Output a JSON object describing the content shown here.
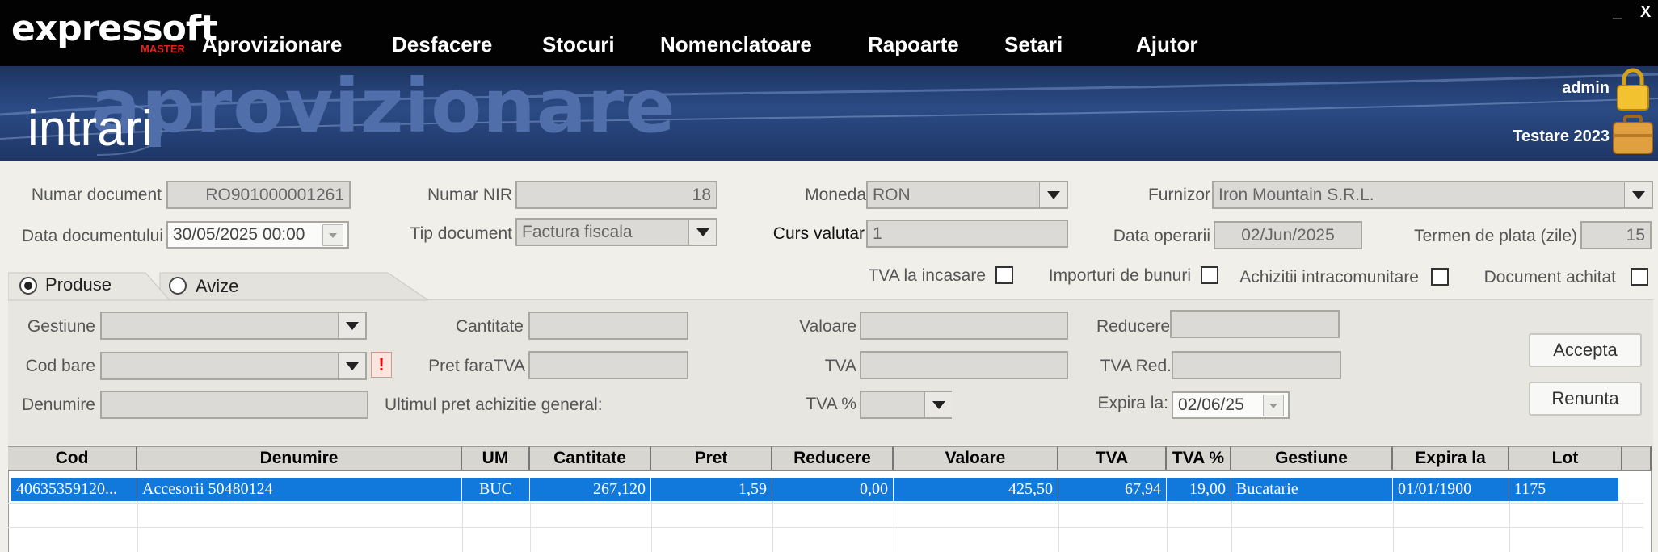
{
  "app": {
    "logo": "expressoft",
    "logo_sub": "MASTER",
    "menu": [
      "Aprovizionare",
      "Desfacere",
      "Stocuri",
      "Nomenclatoare",
      "Rapoarte",
      "Setari",
      "Ajutor"
    ],
    "minimize": "_",
    "close": "X"
  },
  "banner": {
    "watermark": "aprovizionare",
    "title": "intrari",
    "user": "admin",
    "company": "Testare 2023"
  },
  "doc": {
    "numar_document_label": "Numar document",
    "numar_document": "RO901000001261",
    "numar_nir_label": "Numar NIR",
    "numar_nir": "18",
    "moneda_label": "Moneda",
    "moneda": "RON",
    "furnizor_label": "Furnizor",
    "furnizor": "Iron Mountain S.R.L.",
    "data_doc_label": "Data documentului",
    "data_doc": "30/05/2025 00:00",
    "tip_doc_label": "Tip document",
    "tip_doc": "Factura fiscala",
    "curs_label": "Curs valutar",
    "curs": "1",
    "data_op_label": "Data operarii",
    "data_op": "02/Jun/2025",
    "termen_label": "Termen de plata (zile)",
    "termen": "15"
  },
  "tabs": {
    "produse": "Produse",
    "avize": "Avize"
  },
  "checks": {
    "tva_incasare": "TVA la incasare",
    "importuri": "Importuri de bunuri",
    "achizitii": "Achizitii intracomunitare",
    "achitat": "Document achitat"
  },
  "line": {
    "gestiune_label": "Gestiune",
    "cod_bare_label": "Cod bare",
    "warning": "!",
    "denumire_label": "Denumire",
    "cantitate_label": "Cantitate",
    "pret_label": "Pret faraTVA",
    "ultimul_pret_label": "Ultimul pret achizitie general:",
    "valoare_label": "Valoare",
    "tva_label": "TVA",
    "tva_pct_label": "TVA %",
    "reducere_label": "Reducere",
    "tva_red_label": "TVA Red.",
    "expira_label": "Expira la:",
    "expira": "02/06/25",
    "accepta": "Accepta",
    "renunta": "Renunta"
  },
  "grid": {
    "columns": [
      "Cod",
      "Denumire",
      "UM",
      "Cantitate",
      "Pret",
      "Reducere",
      "Valoare",
      "TVA",
      "TVA %",
      "Gestiune",
      "Expira la",
      "Lot"
    ],
    "rows": [
      [
        "40635359120...",
        "Accesorii 50480124",
        "BUC",
        "267,120",
        "1,59",
        "0,00",
        "425,50",
        "67,94",
        "19,00",
        "Bucatarie",
        "01/01/1900",
        "1175"
      ]
    ]
  },
  "colors": {
    "selection": "#1178dc",
    "banner": "#2b4b85",
    "warning": "#e00000"
  }
}
